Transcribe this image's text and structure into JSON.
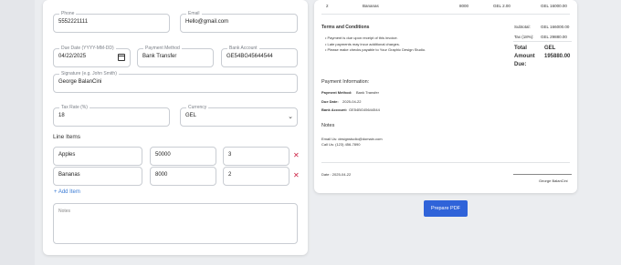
{
  "form": {
    "phone": {
      "label": "Phone",
      "value": "5552221111"
    },
    "email": {
      "label": "Email",
      "value": "Hello@gmail.com"
    },
    "due_date": {
      "label": "Due Date (YYYY-MM-DD)",
      "value": "04/22/2025"
    },
    "payment_method": {
      "label": "Payment Method",
      "value": "Bank Transfer"
    },
    "bank_account": {
      "label": "Bank Account",
      "value": "GE54BG45644544"
    },
    "signature": {
      "label": "Signature (e.g. John Smith)",
      "value": "George BalanCini"
    },
    "tax_rate": {
      "label": "Tax Rate (%)",
      "value": "18"
    },
    "currency": {
      "label": "Currency",
      "value": "GEL"
    },
    "line_items_title": "Line Items",
    "line_items": [
      {
        "name": "Apples",
        "price": "50000",
        "qty": "3"
      },
      {
        "name": "Bananas",
        "price": "8000",
        "qty": "2"
      }
    ],
    "remove_icon": "✕",
    "add_item": "+ Add Item",
    "notes_placeholder": "Notes"
  },
  "preview": {
    "table_row": {
      "num": "2",
      "name": "Bananas",
      "price": "8000",
      "total": "GEL 2.00",
      "amount": "GEL 16000.00"
    },
    "terms_title": "Terms and Conditions",
    "terms": [
      "• Payment is due upon receipt of this invoice.",
      "• Late payments may incur additional charges.",
      "• Please make checks payable to Your Graphic Design Studio."
    ],
    "subtotal_label": "Subtotal:",
    "subtotal_value": "GEL 166000.00",
    "tax_label": "Tax (18%):",
    "tax_value": "GEL 29880.00",
    "total_label_1": "Total",
    "total_label_2": "Amount",
    "total_label_3": "Due:",
    "total_currency": "GEL",
    "total_value": "195880.00",
    "payment_title": "Payment Information:",
    "payment_method_label": "Payment Method:",
    "payment_method_value": "Bank Transfer",
    "due_date_label": "Due Date:",
    "due_date_value": "2025-04-22",
    "bank_label": "Bank Account:",
    "bank_value": "GE54BG45644544",
    "notes_title": "Notes",
    "contact_email": "Email Us: designstudio@domain.com",
    "contact_phone": "Call Us: (123) 456-7890",
    "date_line": "Date : 2025-04-22",
    "signature_name": "George BalanCini"
  },
  "prepare_button": "Prepare PDF"
}
